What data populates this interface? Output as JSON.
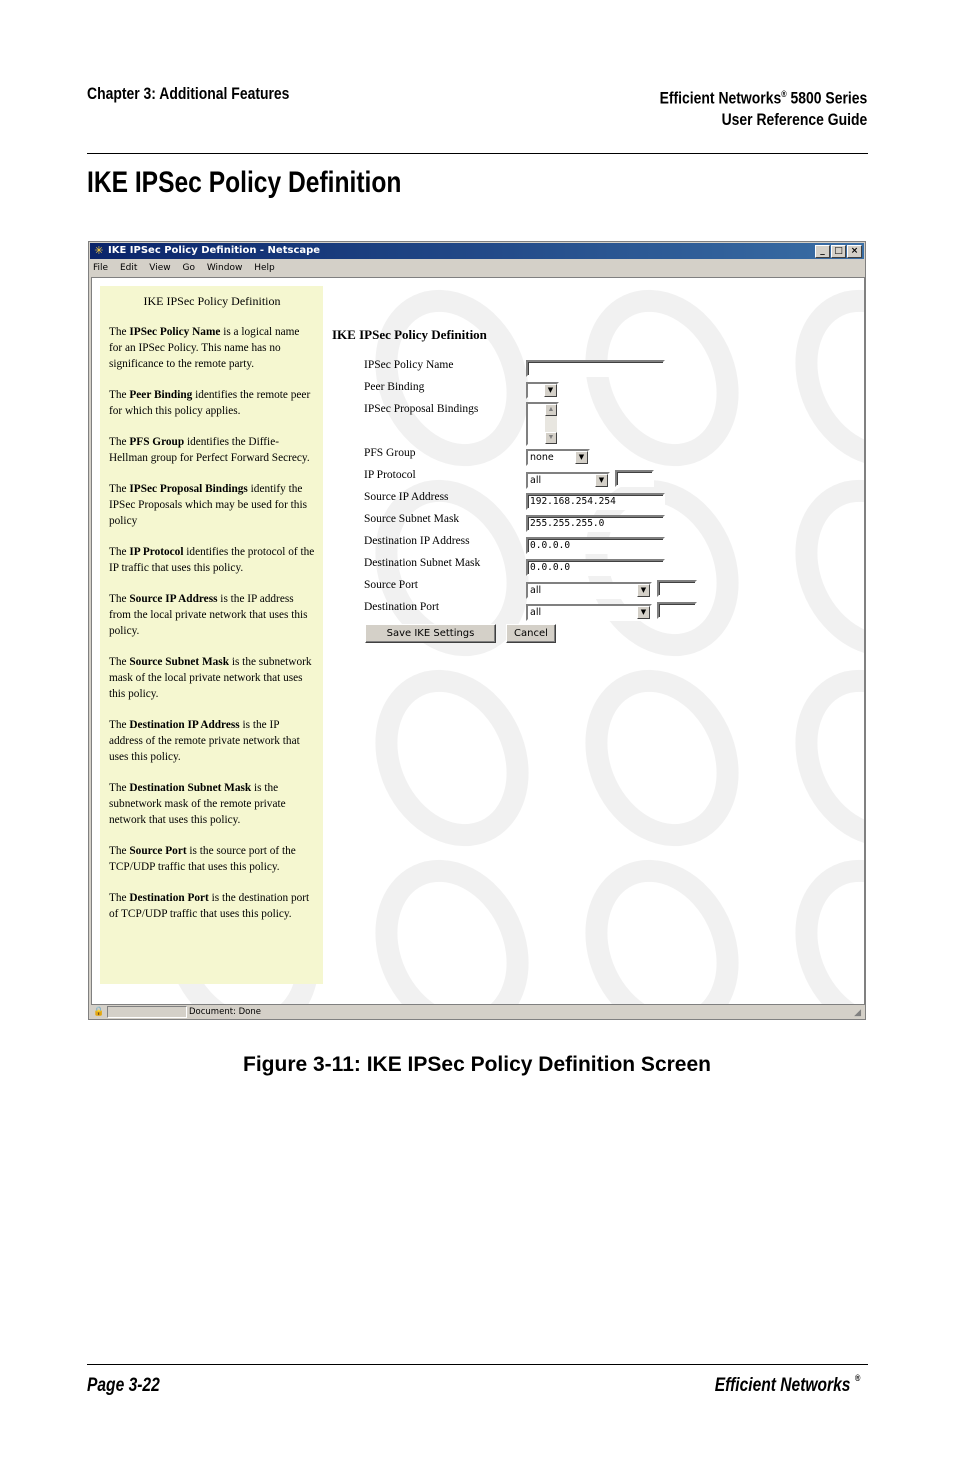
{
  "page_header": {
    "left": "Chapter 3: Additional Features",
    "right_line1": "Efficient Networks",
    "right_reg": "®",
    "right_line1_suffix": " 5800 Series",
    "right_line2": "User Reference Guide"
  },
  "page_title": "IKE IPSec Policy Definition",
  "browser": {
    "title": "IKE IPSec Policy Definition - Netscape",
    "menu": [
      "File",
      "Edit",
      "View",
      "Go",
      "Window",
      "Help"
    ],
    "status": "Document: Done"
  },
  "help": {
    "heading": "IKE IPSec Policy Definition",
    "paragraphs": [
      {
        "pre": "The ",
        "term": "IPSec Policy Name",
        "post": " is a logical name for an IPSec Policy. This name has no significance to the remote party."
      },
      {
        "pre": "The ",
        "term": "Peer Binding",
        "post": " identifies the remote peer for which this policy applies."
      },
      {
        "pre": "The ",
        "term": "PFS Group",
        "post": " identifies the Diffie-Hellman group for Perfect Forward Secrecy."
      },
      {
        "pre": "The ",
        "term": "IPSec Proposal Bindings",
        "post": " identify the IPSec Proposals which may be used for this policy"
      },
      {
        "pre": "The ",
        "term": "IP Protocol",
        "post": " identifies the protocol of the IP traffic that uses this policy."
      },
      {
        "pre": "The ",
        "term": "Source IP Address",
        "post": " is the IP address from the local private network that uses this policy."
      },
      {
        "pre": "The ",
        "term": "Source Subnet Mask",
        "post": " is the subnetwork mask of the local private network that uses this policy."
      },
      {
        "pre": "The ",
        "term": "Destination IP Address",
        "post": " is the IP address of the remote private network that uses this policy."
      },
      {
        "pre": "The ",
        "term": "Destination Subnet Mask",
        "post": " is the subnetwork mask of the remote private network that uses this policy."
      },
      {
        "pre": "The ",
        "term": "Source Port",
        "post": " is the source port of the TCP/UDP traffic that uses this policy."
      },
      {
        "pre": "The ",
        "term": "Destination Port",
        "post": " is the destination port of TCP/UDP traffic that uses this policy."
      }
    ]
  },
  "form": {
    "title": "IKE IPSec Policy Definition",
    "labels": {
      "policy_name": "IPSec Policy Name",
      "peer_binding": "Peer Binding",
      "proposal_bindings": "IPSec Proposal Bindings",
      "pfs_group": "PFS Group",
      "ip_protocol": "IP Protocol",
      "source_ip": "Source IP Address",
      "source_mask": "Source Subnet Mask",
      "dest_ip": "Destination IP Address",
      "dest_mask": "Destination Subnet Mask",
      "source_port": "Source Port",
      "dest_port": "Destination Port"
    },
    "values": {
      "policy_name": "",
      "peer_binding": "",
      "pfs_group": "none",
      "ip_protocol": "all",
      "ip_protocol_number": "",
      "source_ip": "192.168.254.254",
      "source_mask": "255.255.255.0",
      "dest_ip": "0.0.0.0",
      "dest_mask": "0.0.0.0",
      "source_port": "all",
      "source_port_number": "",
      "dest_port": "all",
      "dest_port_number": ""
    },
    "save_label": "Save IKE Settings",
    "cancel_label": "Cancel"
  },
  "caption": "Figure 3-11:  IKE IPSec Policy Definition Screen",
  "footer": {
    "left": "Page 3-22",
    "right": "Efficient Networks",
    "right_reg": "®"
  },
  "icons": {
    "app": "netscape-icon",
    "dropdown": "chevron-down-icon",
    "scroll_up": "arrow-up-icon",
    "scroll_down": "arrow-down-icon",
    "security": "lock-icon",
    "resize": "resize-grip-icon"
  }
}
